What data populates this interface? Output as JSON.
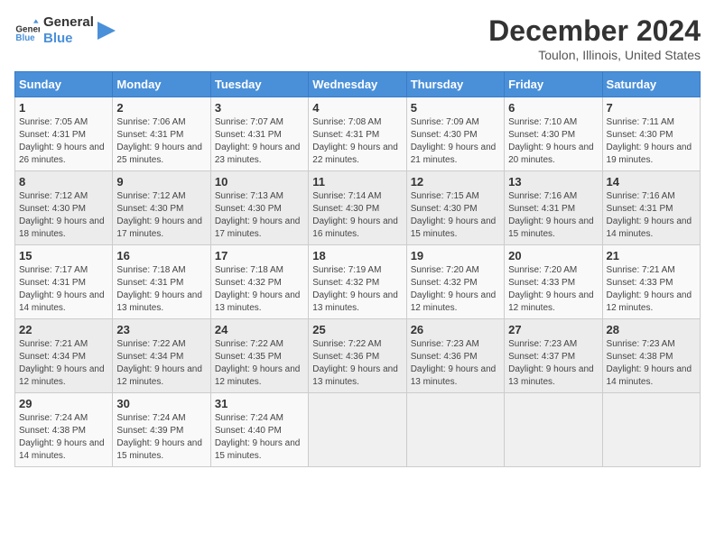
{
  "header": {
    "logo_line1": "General",
    "logo_line2": "Blue",
    "title": "December 2024",
    "subtitle": "Toulon, Illinois, United States"
  },
  "weekdays": [
    "Sunday",
    "Monday",
    "Tuesday",
    "Wednesday",
    "Thursday",
    "Friday",
    "Saturday"
  ],
  "weeks": [
    [
      {
        "day": "1",
        "sunrise": "7:05 AM",
        "sunset": "4:31 PM",
        "daylight": "9 hours and 26 minutes."
      },
      {
        "day": "2",
        "sunrise": "7:06 AM",
        "sunset": "4:31 PM",
        "daylight": "9 hours and 25 minutes."
      },
      {
        "day": "3",
        "sunrise": "7:07 AM",
        "sunset": "4:31 PM",
        "daylight": "9 hours and 23 minutes."
      },
      {
        "day": "4",
        "sunrise": "7:08 AM",
        "sunset": "4:31 PM",
        "daylight": "9 hours and 22 minutes."
      },
      {
        "day": "5",
        "sunrise": "7:09 AM",
        "sunset": "4:30 PM",
        "daylight": "9 hours and 21 minutes."
      },
      {
        "day": "6",
        "sunrise": "7:10 AM",
        "sunset": "4:30 PM",
        "daylight": "9 hours and 20 minutes."
      },
      {
        "day": "7",
        "sunrise": "7:11 AM",
        "sunset": "4:30 PM",
        "daylight": "9 hours and 19 minutes."
      }
    ],
    [
      {
        "day": "8",
        "sunrise": "7:12 AM",
        "sunset": "4:30 PM",
        "daylight": "9 hours and 18 minutes."
      },
      {
        "day": "9",
        "sunrise": "7:12 AM",
        "sunset": "4:30 PM",
        "daylight": "9 hours and 17 minutes."
      },
      {
        "day": "10",
        "sunrise": "7:13 AM",
        "sunset": "4:30 PM",
        "daylight": "9 hours and 17 minutes."
      },
      {
        "day": "11",
        "sunrise": "7:14 AM",
        "sunset": "4:30 PM",
        "daylight": "9 hours and 16 minutes."
      },
      {
        "day": "12",
        "sunrise": "7:15 AM",
        "sunset": "4:30 PM",
        "daylight": "9 hours and 15 minutes."
      },
      {
        "day": "13",
        "sunrise": "7:16 AM",
        "sunset": "4:31 PM",
        "daylight": "9 hours and 15 minutes."
      },
      {
        "day": "14",
        "sunrise": "7:16 AM",
        "sunset": "4:31 PM",
        "daylight": "9 hours and 14 minutes."
      }
    ],
    [
      {
        "day": "15",
        "sunrise": "7:17 AM",
        "sunset": "4:31 PM",
        "daylight": "9 hours and 14 minutes."
      },
      {
        "day": "16",
        "sunrise": "7:18 AM",
        "sunset": "4:31 PM",
        "daylight": "9 hours and 13 minutes."
      },
      {
        "day": "17",
        "sunrise": "7:18 AM",
        "sunset": "4:32 PM",
        "daylight": "9 hours and 13 minutes."
      },
      {
        "day": "18",
        "sunrise": "7:19 AM",
        "sunset": "4:32 PM",
        "daylight": "9 hours and 13 minutes."
      },
      {
        "day": "19",
        "sunrise": "7:20 AM",
        "sunset": "4:32 PM",
        "daylight": "9 hours and 12 minutes."
      },
      {
        "day": "20",
        "sunrise": "7:20 AM",
        "sunset": "4:33 PM",
        "daylight": "9 hours and 12 minutes."
      },
      {
        "day": "21",
        "sunrise": "7:21 AM",
        "sunset": "4:33 PM",
        "daylight": "9 hours and 12 minutes."
      }
    ],
    [
      {
        "day": "22",
        "sunrise": "7:21 AM",
        "sunset": "4:34 PM",
        "daylight": "9 hours and 12 minutes."
      },
      {
        "day": "23",
        "sunrise": "7:22 AM",
        "sunset": "4:34 PM",
        "daylight": "9 hours and 12 minutes."
      },
      {
        "day": "24",
        "sunrise": "7:22 AM",
        "sunset": "4:35 PM",
        "daylight": "9 hours and 12 minutes."
      },
      {
        "day": "25",
        "sunrise": "7:22 AM",
        "sunset": "4:36 PM",
        "daylight": "9 hours and 13 minutes."
      },
      {
        "day": "26",
        "sunrise": "7:23 AM",
        "sunset": "4:36 PM",
        "daylight": "9 hours and 13 minutes."
      },
      {
        "day": "27",
        "sunrise": "7:23 AM",
        "sunset": "4:37 PM",
        "daylight": "9 hours and 13 minutes."
      },
      {
        "day": "28",
        "sunrise": "7:23 AM",
        "sunset": "4:38 PM",
        "daylight": "9 hours and 14 minutes."
      }
    ],
    [
      {
        "day": "29",
        "sunrise": "7:24 AM",
        "sunset": "4:38 PM",
        "daylight": "9 hours and 14 minutes."
      },
      {
        "day": "30",
        "sunrise": "7:24 AM",
        "sunset": "4:39 PM",
        "daylight": "9 hours and 15 minutes."
      },
      {
        "day": "31",
        "sunrise": "7:24 AM",
        "sunset": "4:40 PM",
        "daylight": "9 hours and 15 minutes."
      },
      null,
      null,
      null,
      null
    ]
  ]
}
